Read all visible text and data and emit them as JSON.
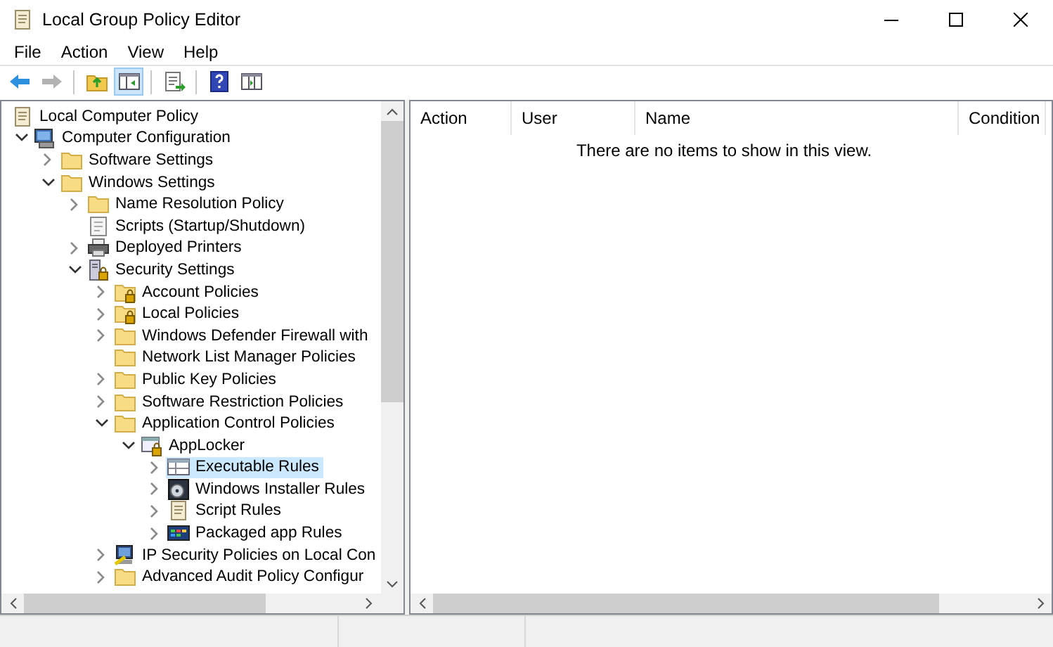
{
  "window": {
    "title": "Local Group Policy Editor"
  },
  "menu": [
    "File",
    "Action",
    "View",
    "Help"
  ],
  "toolbar": [
    {
      "kind": "button",
      "disabled": false,
      "pressed": false
    },
    {
      "kind": "button",
      "disabled": true,
      "pressed": false
    },
    {
      "kind": "separator"
    },
    {
      "kind": "button",
      "disabled": false,
      "pressed": false
    },
    {
      "kind": "button",
      "disabled": false,
      "pressed": true
    },
    {
      "kind": "separator"
    },
    {
      "kind": "button",
      "disabled": false,
      "pressed": false
    },
    {
      "kind": "separator"
    },
    {
      "kind": "button",
      "disabled": false,
      "pressed": false
    },
    {
      "kind": "button",
      "disabled": false,
      "pressed": false
    }
  ],
  "tree": [
    {
      "label": "Local Computer Policy",
      "kind": "policy",
      "selected": false,
      "children": [
        {
          "label": "Computer Configuration",
          "kind": "computer",
          "expanded": true,
          "selected": false,
          "children": [
            {
              "label": "Software Settings",
              "kind": "folder",
              "expanded": false,
              "selected": false
            },
            {
              "label": "Windows Settings",
              "kind": "folder",
              "expanded": true,
              "selected": false,
              "children": [
                {
                  "label": "Name Resolution Policy",
                  "kind": "folder",
                  "expanded": false,
                  "selected": false
                },
                {
                  "label": "Scripts (Startup/Shutdown)",
                  "kind": "script",
                  "selected": false
                },
                {
                  "label": "Deployed Printers",
                  "kind": "printer",
                  "expanded": false,
                  "selected": false
                },
                {
                  "label": "Security Settings",
                  "kind": "security",
                  "expanded": true,
                  "selected": false,
                  "children": [
                    {
                      "label": "Account Policies",
                      "kind": "locked-folder",
                      "expanded": false,
                      "selected": false
                    },
                    {
                      "label": "Local Policies",
                      "kind": "locked-folder",
                      "expanded": false,
                      "selected": false
                    },
                    {
                      "label": "Windows Defender Firewall with",
                      "kind": "folder",
                      "expanded": false,
                      "selected": false
                    },
                    {
                      "label": "Network List Manager Policies",
                      "kind": "folder",
                      "selected": false
                    },
                    {
                      "label": "Public Key Policies",
                      "kind": "folder",
                      "expanded": false,
                      "selected": false
                    },
                    {
                      "label": "Software Restriction Policies",
                      "kind": "folder",
                      "expanded": false,
                      "selected": false
                    },
                    {
                      "label": "Application Control Policies",
                      "kind": "folder",
                      "expanded": true,
                      "selected": false,
                      "children": [
                        {
                          "label": "AppLocker",
                          "kind": "applocker",
                          "expanded": true,
                          "selected": false,
                          "children": [
                            {
                              "label": "Executable Rules",
                              "kind": "rules-table",
                              "expanded": false,
                              "selected": true
                            },
                            {
                              "label": "Windows Installer Rules",
                              "kind": "installer",
                              "expanded": false,
                              "selected": false
                            },
                            {
                              "label": "Script Rules",
                              "kind": "policy",
                              "expanded": false,
                              "selected": false
                            },
                            {
                              "label": "Packaged app Rules",
                              "kind": "packaged",
                              "expanded": false,
                              "selected": false
                            }
                          ]
                        }
                      ]
                    },
                    {
                      "label": "IP Security Policies on Local Con",
                      "kind": "ipsec",
                      "expanded": false,
                      "selected": false
                    },
                    {
                      "label": "Advanced Audit Policy Configur",
                      "kind": "folder",
                      "expanded": false,
                      "selected": false
                    }
                  ]
                }
              ]
            }
          ]
        }
      ]
    }
  ],
  "list": {
    "columns": [
      "Action",
      "User",
      "Name",
      "Condition"
    ],
    "empty_message": "There are no items to show in this view."
  }
}
